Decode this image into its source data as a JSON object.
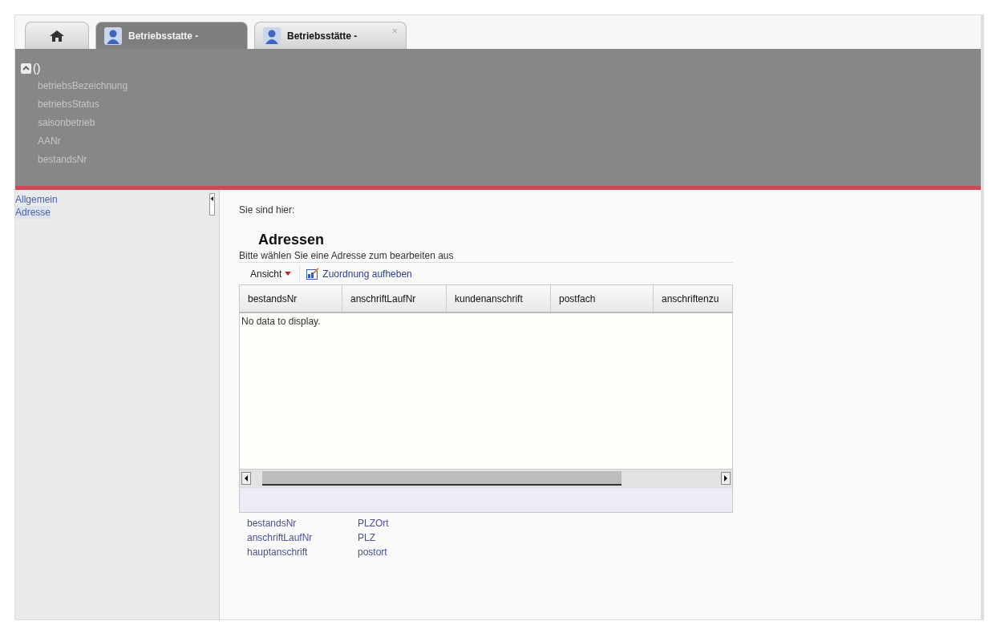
{
  "tabs": [
    {
      "kind": "home",
      "selected": false
    },
    {
      "kind": "record",
      "label": "Betriebsstatte -",
      "selected": true
    },
    {
      "kind": "record",
      "label": "Betriebsstätte -",
      "close": "×",
      "selected": false
    }
  ],
  "header": {
    "toggle_label": "()",
    "expanded": true,
    "fields": [
      "betriebsBezeichnung",
      "betriebsStatus",
      "saisonbetrieb",
      "AANr",
      "bestandsNr"
    ]
  },
  "sidebar": {
    "items": [
      {
        "label": "Allgemein",
        "selected": false
      },
      {
        "label": "Adresse",
        "selected": true
      }
    ]
  },
  "breadcrumb": "Sie sind hier:",
  "section": {
    "title": "Adressen",
    "hint": "Bitte wählen Sie eine Adresse zum bearbeiten aus"
  },
  "toolbar": {
    "view_menu": "Ansicht",
    "action": "Zuordnung aufheben"
  },
  "table": {
    "columns": [
      "bestandsNr",
      "anschriftLaufNr",
      "kundenanschrift",
      "postfach",
      "anschriftenzu"
    ],
    "empty_text": "No data to display."
  },
  "details": [
    {
      "label": "bestandsNr",
      "value": "PLZOrt"
    },
    {
      "label": "anschriftLaufNr",
      "value": "PLZ"
    },
    {
      "label": "hauptanschrift",
      "value": "postort"
    }
  ]
}
